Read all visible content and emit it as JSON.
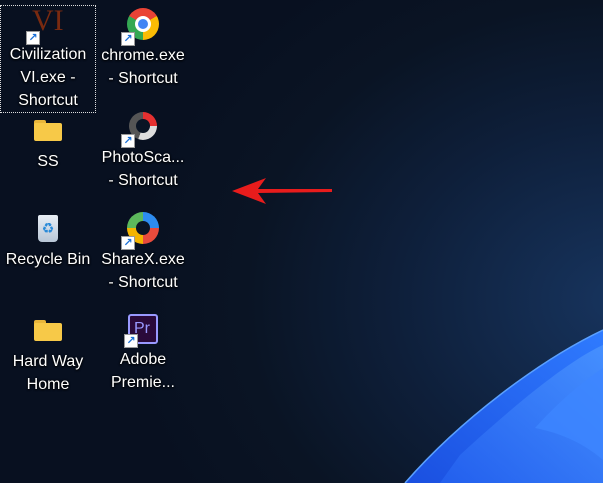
{
  "desktop": {
    "icons": [
      {
        "label": "Civilization VI.exe - Shortcut",
        "icon": "civilization-vi-icon",
        "shortcut": true,
        "selected": true,
        "glyph_text": "VI"
      },
      {
        "label": "chrome.exe - Shortcut",
        "icon": "chrome-icon",
        "shortcut": true
      },
      {
        "label": "SS",
        "icon": "folder-icon"
      },
      {
        "label": "PhotoSca... - Shortcut",
        "icon": "photoscape-icon",
        "shortcut": true
      },
      {
        "label": "Recycle Bin",
        "icon": "recycle-bin-icon"
      },
      {
        "label": "ShareX.exe - Shortcut",
        "icon": "sharex-icon",
        "shortcut": true
      },
      {
        "label": "Hard Way Home",
        "icon": "folder-icon"
      },
      {
        "label": "Adobe Premie...",
        "icon": "adobe-premiere-icon",
        "shortcut": true,
        "glyph_text": "Pr"
      }
    ],
    "annotation": {
      "type": "arrow",
      "color": "#e81c1c",
      "direction": "left"
    },
    "colors": {
      "folder": "#f7c948",
      "premiere": "#9999ff",
      "premiere_bg": "#2a0a3a"
    }
  }
}
